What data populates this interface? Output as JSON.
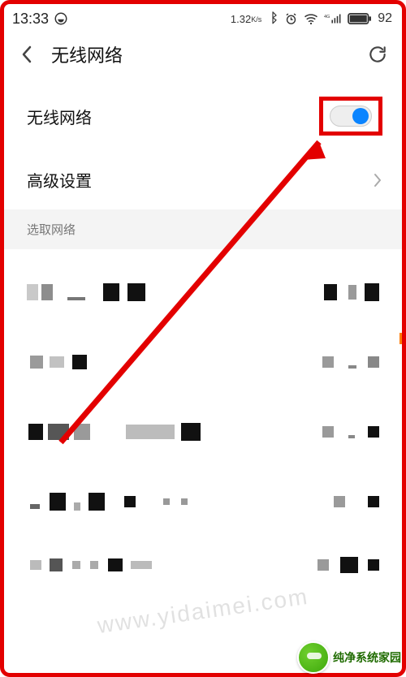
{
  "status_bar": {
    "time": "13:33",
    "net_speed": "1.32",
    "net_speed_unit": "K/s",
    "battery": "92"
  },
  "header": {
    "title": "无线网络"
  },
  "rows": {
    "wifi": {
      "label": "无线网络",
      "toggle_on": true
    },
    "advanced": {
      "label": "高级设置"
    }
  },
  "section": {
    "select_network": "选取网络"
  },
  "branding": {
    "watermark": "www.yidaimei.com",
    "logo_text": "纯净系统家园"
  }
}
